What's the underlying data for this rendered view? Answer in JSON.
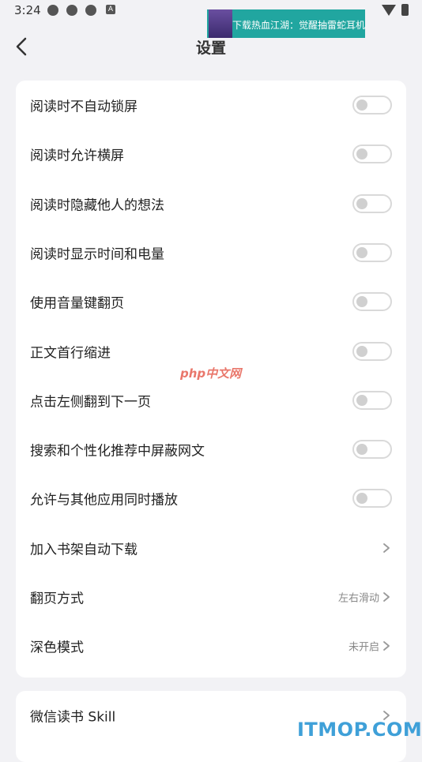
{
  "status_bar": {
    "time": "3:24",
    "icons": [
      "notification-icon",
      "notification-icon",
      "notification-icon",
      "a-icon",
      "wifi-icon",
      "battery-icon"
    ],
    "a_glyph": "A"
  },
  "ad": {
    "text": "下载热血江湖：觉醒抽雷蛇耳机"
  },
  "nav": {
    "title": "设置"
  },
  "settings": [
    {
      "label": "阅读时不自动锁屏",
      "type": "toggle",
      "on": false
    },
    {
      "label": "阅读时允许横屏",
      "type": "toggle",
      "on": false
    },
    {
      "label": "阅读时隐藏他人的想法",
      "type": "toggle",
      "on": false
    },
    {
      "label": "阅读时显示时间和电量",
      "type": "toggle",
      "on": false
    },
    {
      "label": "使用音量键翻页",
      "type": "toggle",
      "on": false
    },
    {
      "label": "正文首行缩进",
      "type": "toggle",
      "on": false
    },
    {
      "label": "点击左侧翻到下一页",
      "type": "toggle",
      "on": false
    },
    {
      "label": "搜索和个性化推荐中屏蔽网文",
      "type": "toggle",
      "on": false
    },
    {
      "label": "允许与其他应用同时播放",
      "type": "toggle",
      "on": false
    },
    {
      "label": "加入书架自动下载",
      "type": "link",
      "value": ""
    },
    {
      "label": "翻页方式",
      "type": "link",
      "value": "左右滑动"
    },
    {
      "label": "深色模式",
      "type": "link",
      "value": "未开启"
    }
  ],
  "settings2": [
    {
      "label": "微信读书 Skill",
      "type": "link",
      "value": ""
    }
  ],
  "watermarks": {
    "php": "php中文网",
    "itmop": "ITMOP.COM"
  }
}
